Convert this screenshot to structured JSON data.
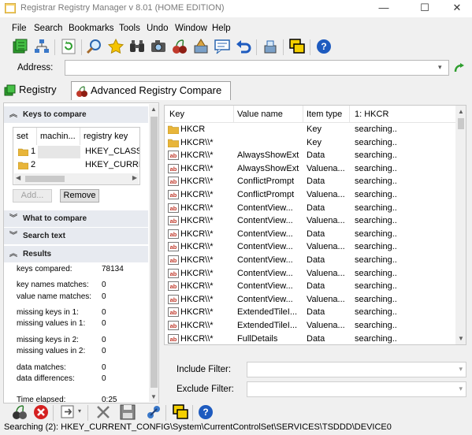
{
  "window": {
    "title": "Registrar Registry Manager v 8.01 (HOME EDITION)",
    "minimize_glyph": "—",
    "maximize_glyph": "☐",
    "close_glyph": "✕"
  },
  "menu": [
    "File",
    "Search",
    "Bookmarks",
    "Tools",
    "Undo",
    "Window",
    "Help"
  ],
  "toolbar_icons": [
    "registry-cube-icon",
    "network-icon",
    "refresh-icon",
    "search-icon",
    "favorites-star-icon",
    "binoculars-icon",
    "snapshot-camera-icon",
    "compare-cherries-icon",
    "cleaner-icon",
    "comment-icon",
    "undo-icon",
    "backup-icon",
    "windows-icon",
    "help-icon"
  ],
  "address": {
    "label": "Address:",
    "value": ""
  },
  "tabs": [
    {
      "label": "Registry",
      "active": false
    },
    {
      "label": "Advanced Registry Compare",
      "active": true
    }
  ],
  "left_panel": {
    "keys_to_compare": {
      "header": "Keys to compare",
      "columns": [
        "set",
        "machin...",
        "registry key"
      ],
      "rows": [
        {
          "set": "1",
          "machine": "",
          "key": "HKEY_CLASSES_ROOT"
        },
        {
          "set": "2",
          "machine": "",
          "key": "HKEY_CURRENT_CONFIG"
        }
      ],
      "add_label": "Add...",
      "remove_label": "Remove"
    },
    "what_to_compare": "What to compare",
    "search_text": "Search text",
    "results": {
      "header": "Results",
      "items": [
        {
          "label": "keys compared:",
          "value": "78134"
        },
        {
          "label": "key names matches:",
          "value": "0"
        },
        {
          "label": "value name matches:",
          "value": "0"
        },
        {
          "label": "missing keys in 1:",
          "value": "0"
        },
        {
          "label": "missing values in 1:",
          "value": "0"
        },
        {
          "label": "missing keys in 2:",
          "value": "0"
        },
        {
          "label": "missing values in 2:",
          "value": "0"
        },
        {
          "label": "data matches:",
          "value": "0"
        },
        {
          "label": "data differences:",
          "value": "0"
        },
        {
          "label": "Time elapsed:",
          "value": "0:25"
        }
      ]
    }
  },
  "grid": {
    "columns": [
      "Key",
      "Value name",
      "Item type",
      "1: HKCR"
    ],
    "rows": [
      {
        "icon": "folder",
        "key": "HKCR",
        "value": "",
        "type": "Key",
        "status": "searching.."
      },
      {
        "icon": "folder",
        "key": "HKCR\\\\*",
        "value": "",
        "type": "Key",
        "status": "searching.."
      },
      {
        "icon": "string",
        "key": "HKCR\\\\*",
        "value": "AlwaysShowExt",
        "type": "Data",
        "status": "searching.."
      },
      {
        "icon": "string",
        "key": "HKCR\\\\*",
        "value": "AlwaysShowExt",
        "type": "Valuena...",
        "status": "searching.."
      },
      {
        "icon": "string",
        "key": "HKCR\\\\*",
        "value": "ConflictPrompt",
        "type": "Data",
        "status": "searching.."
      },
      {
        "icon": "string",
        "key": "HKCR\\\\*",
        "value": "ConflictPrompt",
        "type": "Valuena...",
        "status": "searching.."
      },
      {
        "icon": "string",
        "key": "HKCR\\\\*",
        "value": "ContentView...",
        "type": "Data",
        "status": "searching.."
      },
      {
        "icon": "string",
        "key": "HKCR\\\\*",
        "value": "ContentView...",
        "type": "Valuena...",
        "status": "searching.."
      },
      {
        "icon": "string",
        "key": "HKCR\\\\*",
        "value": "ContentView...",
        "type": "Data",
        "status": "searching.."
      },
      {
        "icon": "string",
        "key": "HKCR\\\\*",
        "value": "ContentView...",
        "type": "Valuena...",
        "status": "searching.."
      },
      {
        "icon": "string",
        "key": "HKCR\\\\*",
        "value": "ContentView...",
        "type": "Data",
        "status": "searching.."
      },
      {
        "icon": "string",
        "key": "HKCR\\\\*",
        "value": "ContentView...",
        "type": "Valuena...",
        "status": "searching.."
      },
      {
        "icon": "string",
        "key": "HKCR\\\\*",
        "value": "ContentView...",
        "type": "Data",
        "status": "searching.."
      },
      {
        "icon": "string",
        "key": "HKCR\\\\*",
        "value": "ContentView...",
        "type": "Valuena...",
        "status": "searching.."
      },
      {
        "icon": "string",
        "key": "HKCR\\\\*",
        "value": "ExtendedTileI...",
        "type": "Data",
        "status": "searching.."
      },
      {
        "icon": "string",
        "key": "HKCR\\\\*",
        "value": "ExtendedTileI...",
        "type": "Valuena...",
        "status": "searching.."
      },
      {
        "icon": "string",
        "key": "HKCR\\\\*",
        "value": "FullDetails",
        "type": "Data",
        "status": "searching.."
      }
    ]
  },
  "filters": {
    "include_label": "Include Filter:",
    "include_value": "",
    "exclude_label": "Exclude Filter:",
    "exclude_value": ""
  },
  "bottom_toolbar_icons": [
    "compare-cherries-icon",
    "stop-icon",
    "go-arrow-icon",
    "delete-x-icon",
    "save-icon",
    "network-link-icon",
    "windows-icon",
    "help-icon"
  ],
  "status_text": "Searching (2): HKEY_CURRENT_CONFIG\\System\\CurrentControlSet\\SERVICES\\TSDDD\\DEVICE0",
  "colors": {
    "section_header_bg": "#e7eaf0",
    "folder": "#e8b53a",
    "string_icon": "#c0392b",
    "help_blue": "#1e5bbf"
  }
}
